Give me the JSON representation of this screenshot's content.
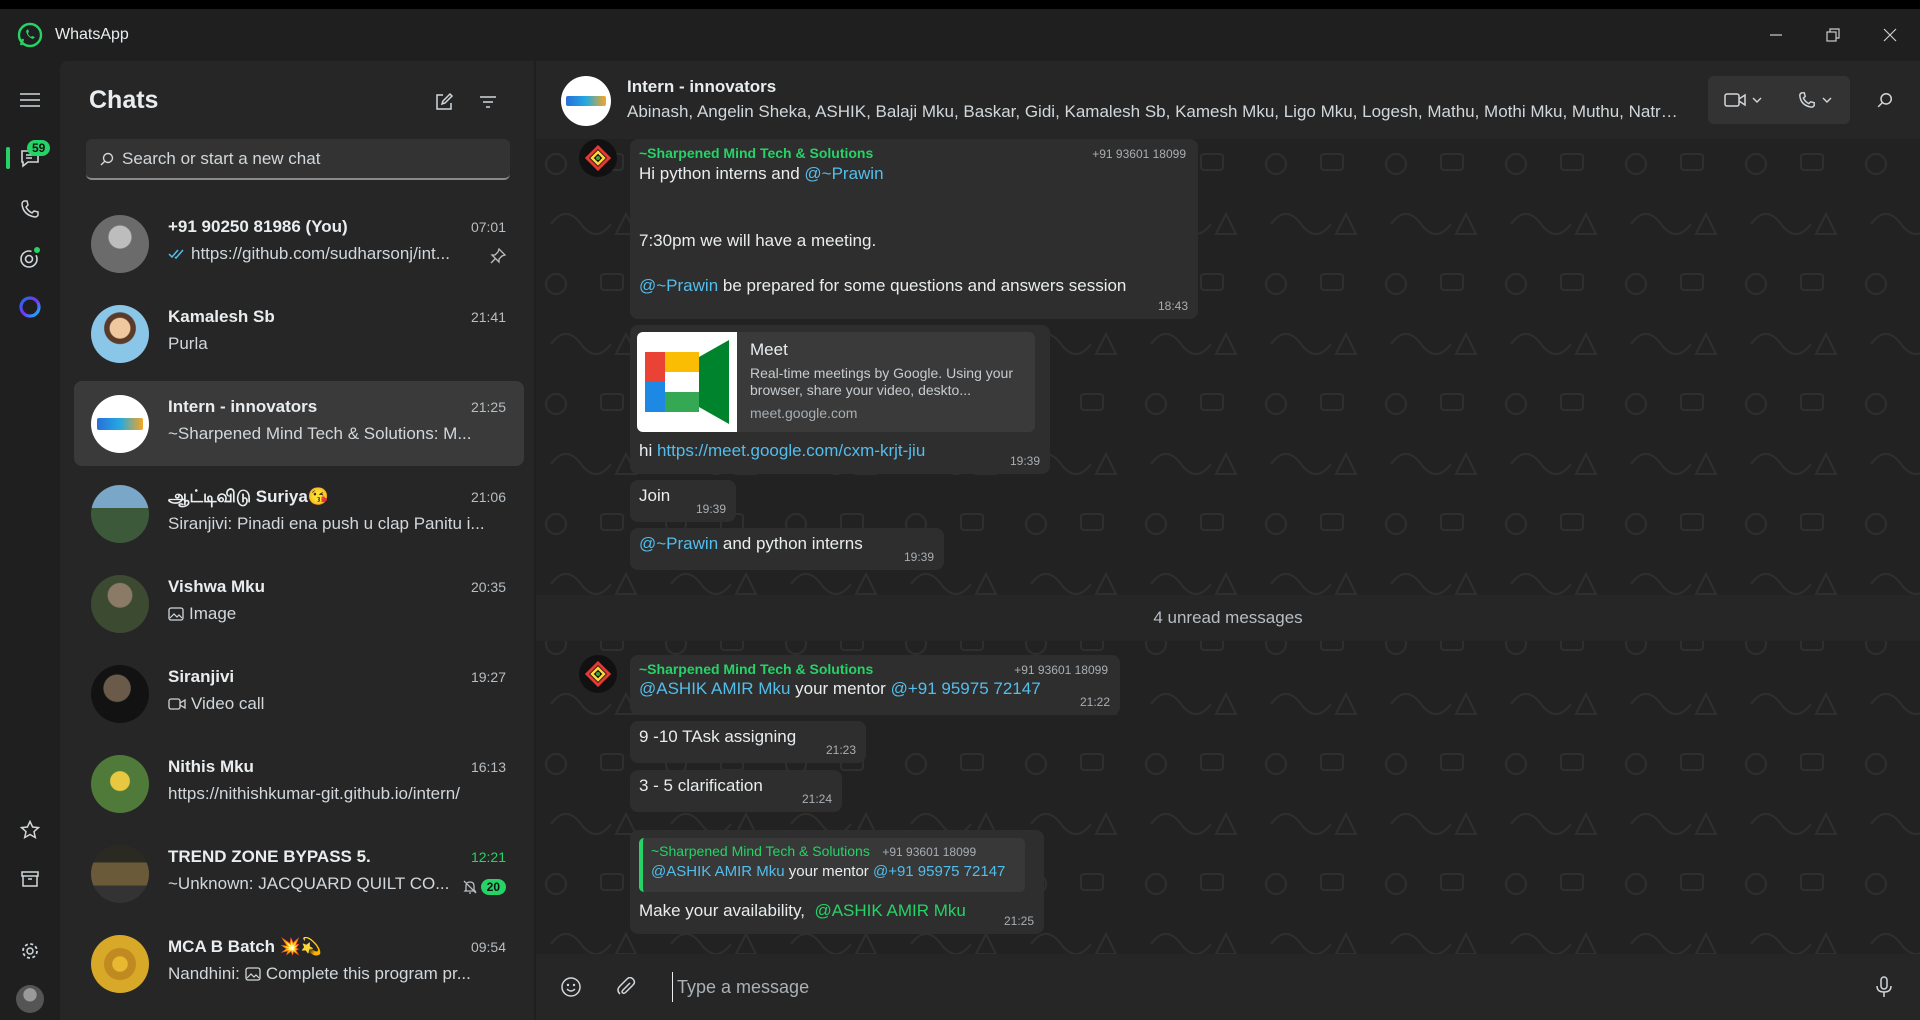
{
  "app": {
    "title": "WhatsApp"
  },
  "rail": {
    "chats_badge": "59"
  },
  "sidebar": {
    "title": "Chats",
    "search_placeholder": "Search or start a new chat",
    "chats": [
      {
        "name": "+91 90250 81986 (You)",
        "time": "07:01",
        "preview": "https://github.com/sudharsonj/int...",
        "pinned": true,
        "read_ticks": true
      },
      {
        "name": "Kamalesh Sb",
        "time": "21:41",
        "preview": "Purla"
      },
      {
        "name": "Intern - innovators",
        "time": "21:25",
        "preview": "~Sharpened Mind Tech & Solutions: M...",
        "selected": true
      },
      {
        "name": "ஆட்டிவிடு Suriya😘",
        "time": "21:06",
        "preview": "Siranjivi: Pinadi ena push u clap Panitu i..."
      },
      {
        "name": "Vishwa Mku",
        "time": "20:35",
        "preview": "Image",
        "preview_icon": "image-icon"
      },
      {
        "name": "Siranjivi",
        "time": "19:27",
        "preview": "Video call",
        "preview_icon": "video-call-icon"
      },
      {
        "name": "Nithis Mku",
        "time": "16:13",
        "preview": "https://nithishkumar-git.github.io/intern/"
      },
      {
        "name": "TREND ZONE BYPASS 5.",
        "time": "12:21",
        "preview": "~Unknown: JACQUARD QUILT CO...",
        "unread": "20",
        "muted": true,
        "time_green": true
      },
      {
        "name": "MCA B Batch 💥💫",
        "time": "09:54",
        "preview_prefix": "Nandhini:",
        "preview": "Complete this program pr...",
        "preview_icon": "image-icon"
      }
    ]
  },
  "chat": {
    "name": "Intern - innovators",
    "members": "Abinash, Angelin Sheka, ASHIK, Balaji Mku, Baskar, Gidi, Kamalesh Sb, Kamesh Mku, Ligo Mku, Logesh, Mathu, Mothi Mku, Muthu, Natraj...",
    "messages": {
      "m1": {
        "sender": "~Sharpened Mind Tech & Solutions",
        "phone": "+91 93601 18099",
        "line1_pre": "Hi python interns and ",
        "line1_mention": "@~Prawin",
        "line2": "7:30pm we will have a meeting.",
        "line3_mention": "@~Prawin",
        "line3_post": " be prepared for some questions and answers session",
        "time": "18:43"
      },
      "m2": {
        "card_title": "Meet",
        "card_desc": "Real-time meetings by Google. Using your browser, share your video, deskto...",
        "card_domain": "meet.google.com",
        "text_pre": "hi ",
        "link": "https://meet.google.com/cxm-krjt-jiu",
        "time": "19:39"
      },
      "m3": {
        "text": "Join",
        "time": "19:39"
      },
      "m4": {
        "mention": "@~Prawin",
        "text": " and python interns",
        "time": "19:39"
      },
      "unread_label": "4 unread messages",
      "m5": {
        "sender": "~Sharpened Mind Tech & Solutions",
        "phone": "+91 93601 18099",
        "mention1": "@ASHIK AMIR Mku",
        "mid": " your mentor ",
        "mention2": "@+91 95975 72147",
        "time": "21:22"
      },
      "m6": {
        "text": "9 -10 TAsk assigning",
        "time": "21:23"
      },
      "m7": {
        "text": "3 - 5 clarification",
        "time": "21:24"
      },
      "m8": {
        "quote_sender": "~Sharpened Mind Tech & Solutions",
        "quote_phone": "+91 93601 18099",
        "quote_mention1": "@ASHIK AMIR Mku",
        "quote_mid": " your mentor ",
        "quote_mention2": "@+91 95975 72147",
        "text": "Make your availability,",
        "mention": "@ASHIK AMIR Mku",
        "time": "21:25"
      }
    }
  },
  "composer": {
    "placeholder": "Type a message"
  },
  "colors": {
    "accent": "#25d366",
    "mention": "#53bdeb",
    "panel": "#262626",
    "bubble": "#2e2e2e"
  }
}
